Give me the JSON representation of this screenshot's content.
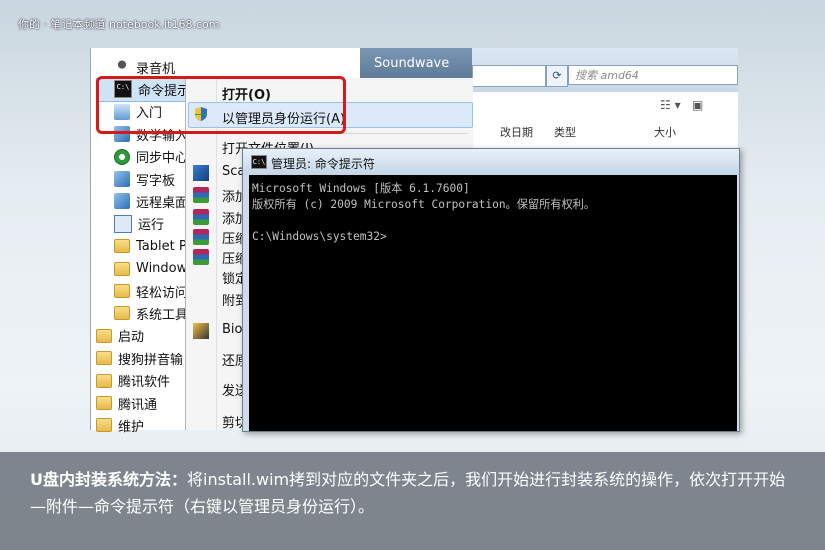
{
  "watermark": "你的 · 笔记本频道 notebook.it168.com",
  "start_menu": {
    "items": [
      {
        "label": "录音机",
        "icon": "microphone-icon"
      },
      {
        "label": "命令提示",
        "icon": "cmd-icon"
      },
      {
        "label": "入门",
        "icon": "getting-started-icon"
      },
      {
        "label": "数学输入",
        "icon": "math-input-icon"
      },
      {
        "label": "同步中心",
        "icon": "sync-center-icon"
      },
      {
        "label": "写字板",
        "icon": "wordpad-icon"
      },
      {
        "label": "远程桌面",
        "icon": "remote-desktop-icon"
      },
      {
        "label": "运行",
        "icon": "run-icon"
      },
      {
        "label": "Tablet P",
        "icon": "folder-icon"
      },
      {
        "label": "Window",
        "icon": "folder-icon"
      },
      {
        "label": "轻松访问",
        "icon": "folder-icon"
      },
      {
        "label": "系统工具",
        "icon": "folder-icon"
      },
      {
        "label": "启动",
        "icon": "folder-icon"
      },
      {
        "label": "搜狗拼音输",
        "icon": "folder-icon"
      },
      {
        "label": "腾讯软件",
        "icon": "folder-icon"
      },
      {
        "label": "腾讯通",
        "icon": "folder-icon"
      },
      {
        "label": "维护",
        "icon": "folder-icon"
      }
    ]
  },
  "context_menu": {
    "open": "打开(O)",
    "run_as_admin": "以管理员身份运行(A)",
    "open_location": "打开文件位置(I)",
    "items": [
      "Sca",
      "添加",
      "添加",
      "压缩",
      "压缩",
      "锁定",
      "附到",
      "Bio",
      "还原",
      "发送",
      "剪切"
    ]
  },
  "explorer": {
    "title": "Soundwave",
    "search_placeholder": "搜索 amd64",
    "col_date": "改日期",
    "col_type": "类型",
    "col_size": "大小"
  },
  "cmd": {
    "title": "管理员: 命令提示符",
    "line1": "Microsoft Windows [版本 6.1.7600]",
    "line2": "版权所有 (c) 2009 Microsoft Corporation。保留所有权利。",
    "line3": "",
    "line4": "C:\\Windows\\system32>"
  },
  "caption": {
    "bold": "U盘内封装系统方法：",
    "text": "将install.wim拷到对应的文件夹之后，我们开始进行封装系统的操作，依次打开开始—附件—命令提示符（右键以管理员身份运行）。"
  }
}
